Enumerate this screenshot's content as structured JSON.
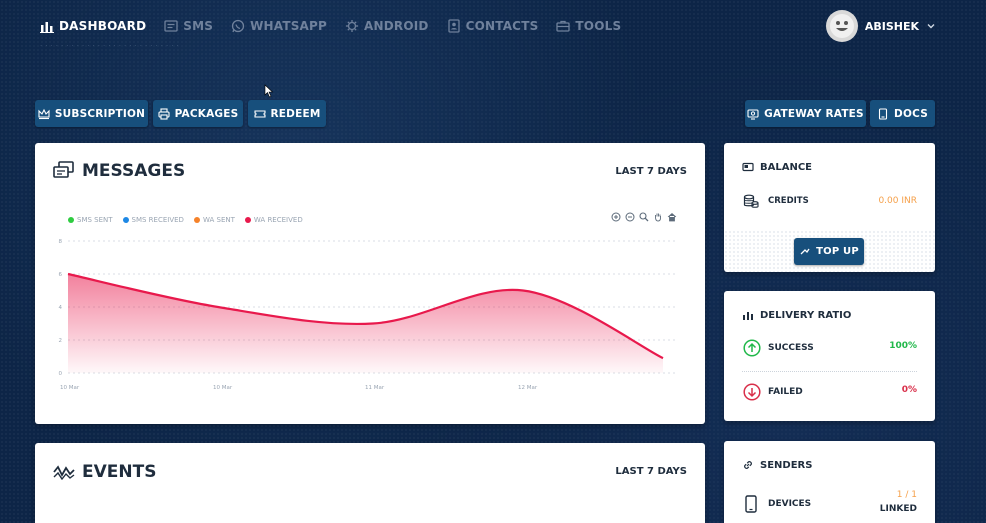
{
  "nav": {
    "items": [
      {
        "label": "DASHBOARD",
        "icon": "bar-chart-icon",
        "active": true
      },
      {
        "label": "SMS",
        "icon": "sms-icon",
        "active": false
      },
      {
        "label": "WHATSAPP",
        "icon": "whatsapp-icon",
        "active": false
      },
      {
        "label": "ANDROID",
        "icon": "android-icon",
        "active": false
      },
      {
        "label": "CONTACTS",
        "icon": "contacts-icon",
        "active": false
      },
      {
        "label": "TOOLS",
        "icon": "toolbox-icon",
        "active": false
      }
    ],
    "user": "ABISHEK"
  },
  "actions": {
    "subscription": "SUBSCRIPTION",
    "packages": "PACKAGES",
    "redeem": "REDEEM",
    "gateway_rates": "GATEWAY RATES",
    "docs": "DOCS"
  },
  "messages": {
    "title": "MESSAGES",
    "period": "LAST 7 DAYS"
  },
  "events": {
    "title": "EVENTS",
    "period": "LAST 7 DAYS"
  },
  "balance": {
    "title": "BALANCE",
    "credits_label": "CREDITS",
    "credits_value": "0.00 INR",
    "topup": "TOP UP"
  },
  "delivery": {
    "title": "DELIVERY RATIO",
    "success_label": "SUCCESS",
    "success_value": "100%",
    "failed_label": "FAILED",
    "failed_value": "0%"
  },
  "senders": {
    "title": "SENDERS",
    "devices_label": "DEVICES",
    "devices_count": "1 / 1",
    "devices_status": "LINKED"
  },
  "colors": {
    "sms_sent": "#2ecc40",
    "sms_received": "#1e88e5",
    "wa_sent": "#f5822a",
    "wa_received": "#e8194c",
    "success": "#21b84a",
    "failed": "#d92f4a",
    "credits": "#f5a04a",
    "button": "#174f7c"
  },
  "chart_data": {
    "type": "area",
    "title": "",
    "series_names": [
      "SMS SENT",
      "SMS RECEIVED",
      "WA SENT",
      "WA RECEIVED"
    ],
    "series": [
      {
        "name": "WA RECEIVED",
        "x": [
          "10 Mar",
          "10.5",
          "11 Mar",
          "11.5",
          "12 Mar",
          "12.5"
        ],
        "values": [
          6,
          4,
          3,
          5,
          1,
          0
        ]
      }
    ],
    "x": [
      0,
      1,
      2,
      3,
      4
    ],
    "x_labels": [
      "10 Mar",
      "",
      "11 Mar",
      "",
      "12 Mar"
    ],
    "x_tick_labels": [
      "10 Mar",
      "10 Mar",
      "11 Mar",
      "12 Mar"
    ],
    "y_ticks": [
      "8",
      "6",
      "4",
      "2",
      "0"
    ],
    "ylim": [
      0,
      8
    ],
    "grid": true,
    "legend": "top-left"
  }
}
